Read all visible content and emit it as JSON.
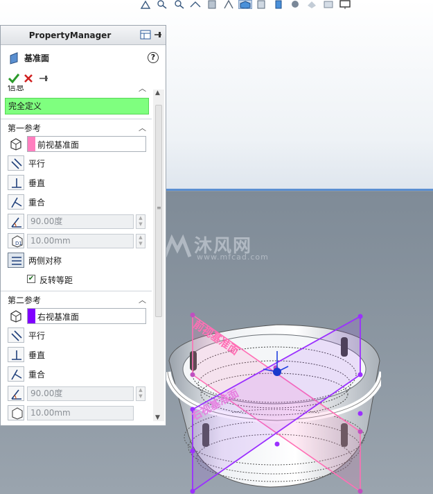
{
  "app": {
    "panel_title": "PropertyManager"
  },
  "feature": {
    "title": "基准面",
    "help": "?"
  },
  "sections": {
    "info": {
      "label": "信息",
      "message": "完全定义"
    },
    "first_ref": {
      "label": "第一参考",
      "selection": "前视基准面",
      "swatch_color": "#ff7fbf",
      "options": {
        "parallel": "平行",
        "perpendicular": "垂直",
        "coincident": "重合",
        "angle_value": "90.00度",
        "offset_value": "10.00mm",
        "mid_plane": "两侧对称",
        "flip_offset": "反转等距"
      }
    },
    "second_ref": {
      "label": "第二参考",
      "selection": "右视基准面",
      "swatch_color": "#8000ff",
      "options": {
        "parallel": "平行",
        "perpendicular": "垂直",
        "coincident": "重合",
        "angle_value": "90.00度",
        "offset_value": "10.00mm"
      }
    }
  },
  "viewport": {
    "front_plane_label": "前视基准面",
    "right_plane_label": "右视基准面",
    "watermark_text": "沐风网",
    "watermark_url": "www.mfcad.com"
  },
  "colors": {
    "front_plane": "#ff6fb5",
    "right_plane": "#9b30ff",
    "fully_defined": "#7fff7f",
    "horizon": "#5b8fd1"
  }
}
